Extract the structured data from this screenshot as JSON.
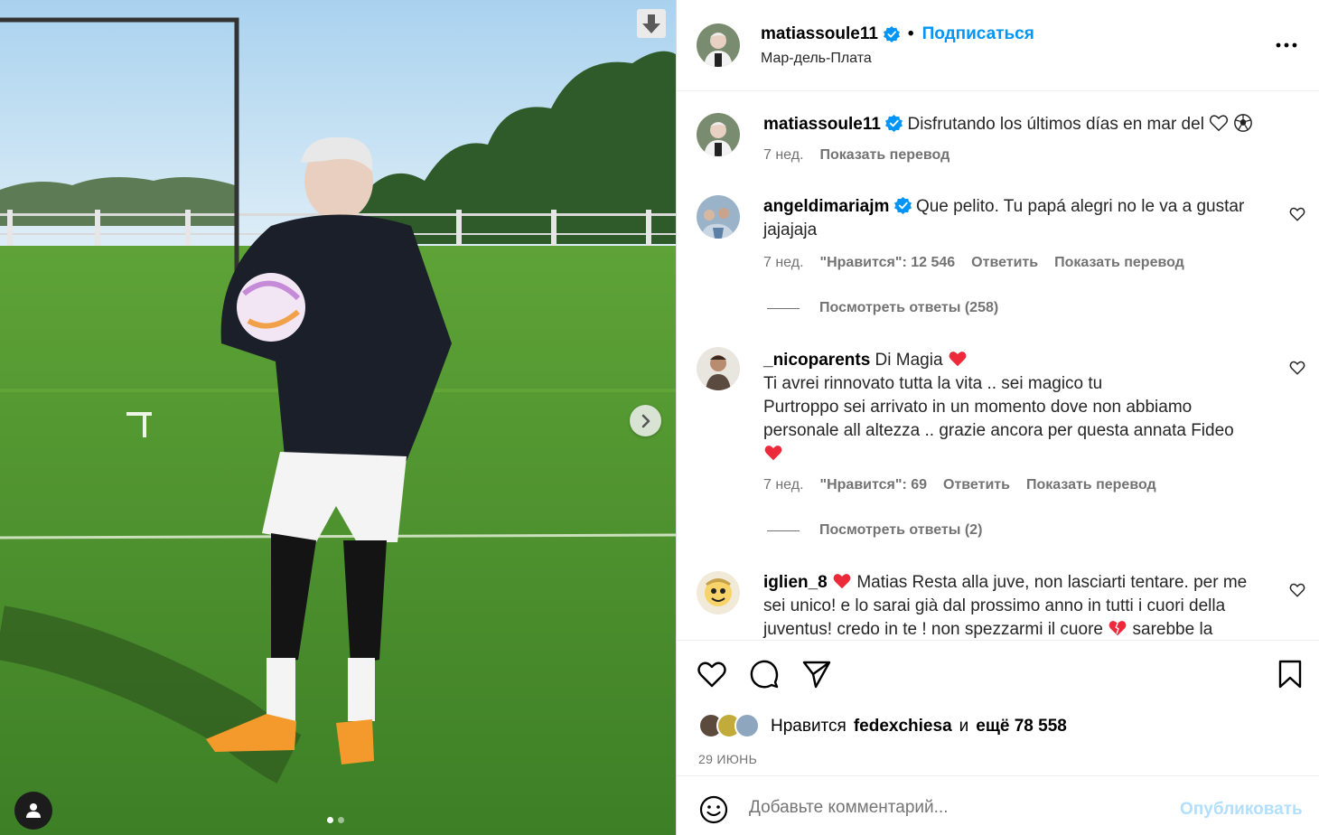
{
  "colors": {
    "accent": "#0095f6",
    "muted": "#737373",
    "heart": "#ed2a3a",
    "disabled_button": "#b2dffc"
  },
  "header": {
    "username": "matiassoule11",
    "bullet": "•",
    "follow_label": "Подписаться",
    "location": "Мар-дель-Плата"
  },
  "media": {
    "slide_index": 1,
    "slide_count": 2
  },
  "caption": {
    "username": "matiassoule11",
    "text": "Disfrutando los últimos días en mar del",
    "time": "7 нед.",
    "translate": "Показать перевод"
  },
  "comments": [
    {
      "username": "angeldimariajm",
      "text": "Que pelito. Tu papá alegri no le va a gustar jajajaja",
      "time": "7 нед.",
      "likes": "\"Нравится\": 12 546",
      "reply": "Ответить",
      "translate": "Показать перевод",
      "view_replies": "Посмотреть ответы (258)"
    },
    {
      "username": "_nicoparents",
      "text_line1": "Di Magia",
      "text_line2": "Ti avrei rinnovato tutta la vita .. sei magico tu",
      "text_line3": "Purtroppo sei arrivato in un momento dove non abbiamo personale all altezza .. grazie ancora per questa annata Fideo",
      "time": "7 нед.",
      "likes": "\"Нравится\": 69",
      "reply": "Ответить",
      "translate": "Показать перевод",
      "view_replies": "Посмотреть ответы (2)"
    },
    {
      "username": "iglien_8",
      "text_part1": "Matias Resta alla juve, non lasciarti tentare. per me sei unico! e lo sarai già dal prossimo anno in tutti i cuori della juventus! credo in te ! non spezzarmi il cuore",
      "text_part2": "sarebbe la"
    }
  ],
  "actions": {
    "icons": [
      "heart-icon",
      "comment-icon",
      "share-icon",
      "bookmark-icon"
    ],
    "liked_by_prefix": "Нравится",
    "liked_by_user": "fedexchiesa",
    "liked_by_connector": "и",
    "liked_by_count": "ещё 78 558",
    "date": "29 ИЮНЬ"
  },
  "add_comment": {
    "placeholder": "Добавьте комментарий...",
    "post_label": "Опубликовать"
  }
}
